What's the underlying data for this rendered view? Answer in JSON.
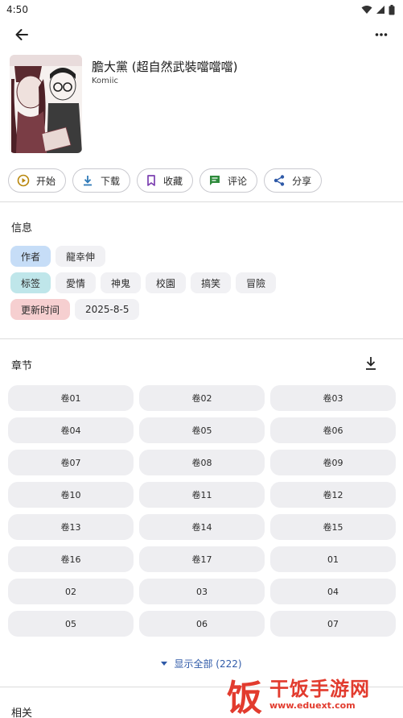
{
  "status_bar": {
    "time": "4:50"
  },
  "header": {
    "back_icon": "arrow-left-icon",
    "more_icon": "more-vert-icon"
  },
  "comic": {
    "title": "膽大黨 (超自然武裝噹噹噹)",
    "source": "Komiic"
  },
  "actions": [
    {
      "label": "开始",
      "icon": "play-circle-icon",
      "color": "#b8860b"
    },
    {
      "label": "下载",
      "icon": "download-icon",
      "color": "#2f7ab8"
    },
    {
      "label": "收藏",
      "icon": "bookmark-icon",
      "color": "#7b3fb0"
    },
    {
      "label": "评论",
      "icon": "comment-icon",
      "color": "#2e8b3c"
    },
    {
      "label": "分享",
      "icon": "share-icon",
      "color": "#2f5aa8"
    }
  ],
  "info": {
    "title": "信息",
    "author_key": "作者",
    "author_value": "龍幸伸",
    "tags_key": "标签",
    "tags": [
      "愛情",
      "神鬼",
      "校園",
      "搞笑",
      "冒險"
    ],
    "updated_key": "更新时间",
    "updated_value": "2025-8-5"
  },
  "chapters": {
    "title": "章节",
    "download_icon": "download-all-icon",
    "items": [
      "卷01",
      "卷02",
      "卷03",
      "卷04",
      "卷05",
      "卷06",
      "卷07",
      "卷08",
      "卷09",
      "卷10",
      "卷11",
      "卷12",
      "卷13",
      "卷14",
      "卷15",
      "卷16",
      "卷17",
      "01",
      "02",
      "03",
      "04",
      "05",
      "06",
      "07"
    ],
    "show_all": "显示全部 (222)"
  },
  "related": {
    "title": "相关"
  },
  "watermark": {
    "char": "饭",
    "title": "干饭手游网",
    "url": "www.eduext.com"
  }
}
